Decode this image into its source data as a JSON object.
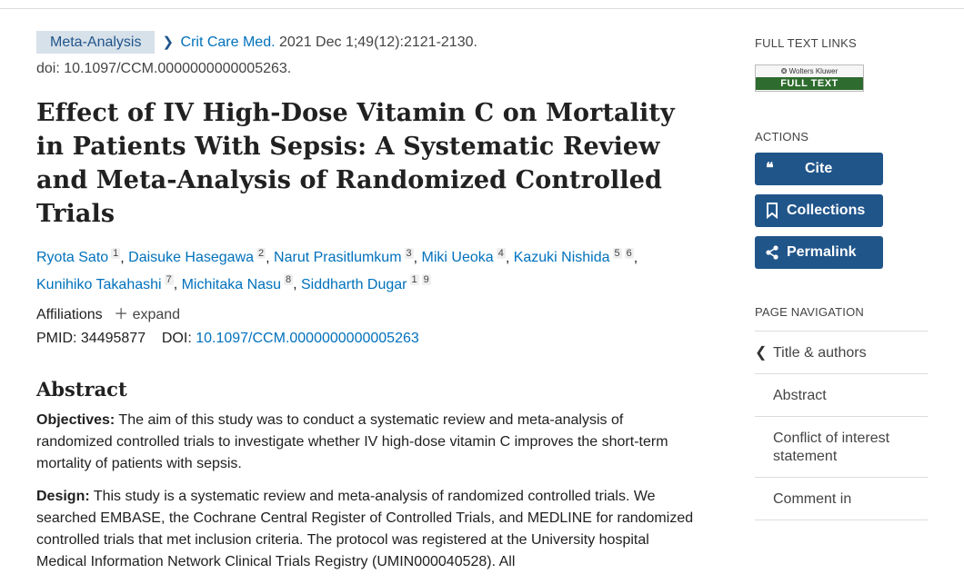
{
  "citation": {
    "pub_type": "Meta-Analysis",
    "journal": "Crit Care Med.",
    "date_info": "2021 Dec 1;49(12):2121-2130.",
    "doi_line": "doi: 10.1097/CCM.0000000000005263."
  },
  "title": "Effect of IV High-Dose Vitamin C on Mortality in Patients With Sepsis: A Systematic Review and Meta-Analysis of Randomized Controlled Trials",
  "authors": [
    {
      "name": "Ryota Sato",
      "sups": [
        "1"
      ]
    },
    {
      "name": "Daisuke Hasegawa",
      "sups": [
        "2"
      ]
    },
    {
      "name": "Narut Prasitlumkum",
      "sups": [
        "3"
      ]
    },
    {
      "name": "Miki Ueoka",
      "sups": [
        "4"
      ]
    },
    {
      "name": "Kazuki Nishida",
      "sups": [
        "5",
        "6"
      ]
    },
    {
      "name": "Kunihiko Takahashi",
      "sups": [
        "7"
      ]
    },
    {
      "name": "Michitaka Nasu",
      "sups": [
        "8"
      ]
    },
    {
      "name": "Siddharth Dugar",
      "sups": [
        "1",
        "9"
      ]
    }
  ],
  "affiliations": {
    "label": "Affiliations",
    "expand_label": "expand"
  },
  "ids": {
    "pmid_label": "PMID:",
    "pmid": "34495877",
    "doi_label": "DOI:",
    "doi": "10.1097/CCM.0000000000005263"
  },
  "abstract": {
    "heading": "Abstract",
    "objectives_label": "Objectives:",
    "objectives_text": "The aim of this study was to conduct a systematic review and meta-analysis of randomized controlled trials to investigate whether IV high-dose vitamin C improves the short-term mortality of patients with sepsis.",
    "design_label": "Design:",
    "design_text": "This study is a systematic review and meta-analysis of randomized controlled trials. We searched EMBASE, the Cochrane Central Register of Controlled Trials, and MEDLINE for randomized controlled trials that met inclusion criteria. The protocol was registered at the University hospital Medical Information Network Clinical Trials Registry (UMIN000040528). All"
  },
  "sidebar": {
    "full_text_heading": "FULL TEXT LINKS",
    "full_text_logo_top": "Wolters Kluwer",
    "full_text_logo_bottom": "FULL TEXT",
    "actions_heading": "ACTIONS",
    "cite_label": "Cite",
    "collections_label": "Collections",
    "permalink_label": "Permalink",
    "page_nav_heading": "PAGE NAVIGATION",
    "nav_items": [
      "Title & authors",
      "Abstract",
      "Conflict of interest statement",
      "Comment in"
    ]
  },
  "colors": {
    "link": "#0071bc",
    "button": "#20558a",
    "badge_bg": "#d7e1ea"
  }
}
